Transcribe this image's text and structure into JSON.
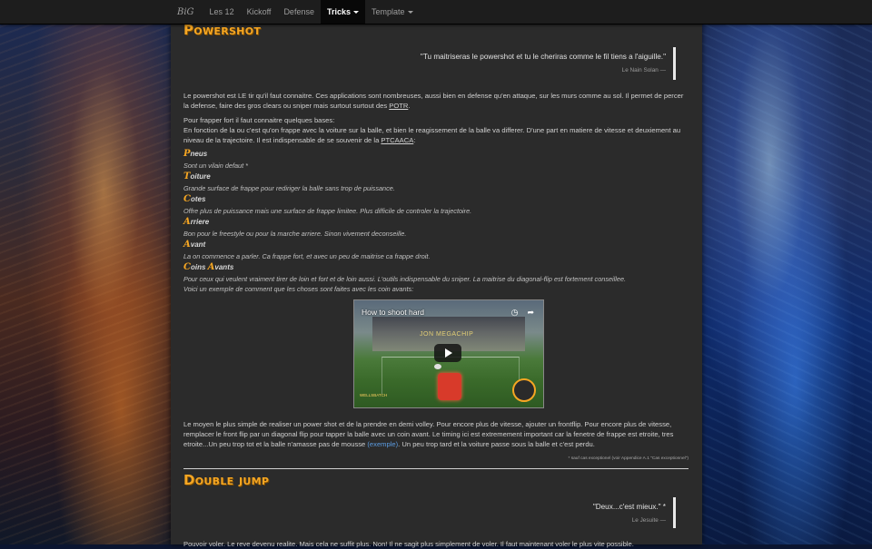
{
  "navbar": {
    "brand": "BiG",
    "items": [
      {
        "label": "Les 12"
      },
      {
        "label": "Kickoff"
      },
      {
        "label": "Defense"
      },
      {
        "label": "Tricks"
      },
      {
        "label": "Template"
      }
    ]
  },
  "sections": {
    "powershot": {
      "title": "Powershot",
      "quote_text": "\"Tu maitriseras le powershot et tu le cheriras comme le fil tiens a l'aiguille.\"",
      "quote_author": "Le Nain Solan —",
      "intro_before": "Le powershot est LE tir qu'il faut connaitre. Ces applications sont nombreuses, aussi bien en defense qu'en attaque, sur les murs comme au sol. Il permet de percer la defense, faire des gros clears ou sniper mais surtout surtout des ",
      "intro_link": "POTR",
      "intro_after": ".",
      "p2_line1": "Pour frapper fort il faut connaitre quelques bases:",
      "p2_body": "En fonction de la ou c'est qu'on frappe avec la voiture sur la balle, et bien le reagissement de la balle va differer. D'une part en matiere de vitesse et deuxiement au niveau de la trajectoire. Il est indispensable de se souvenir de la ",
      "p2_link": "PTCAACA",
      "p2_after": ":",
      "acronym": [
        {
          "letter": "P",
          "rest": "neus",
          "desc": "Sont un vilain defaut *"
        },
        {
          "letter": "T",
          "rest": "oiture",
          "desc": "Grande surface de frappe pour rediriger la balle sans trop de puissance."
        },
        {
          "letter": "C",
          "rest": "otes",
          "desc": "Offre plus de puissance mais une surface de frappe limitee. Plus difficile de controler la trajectoire."
        },
        {
          "letter": "A",
          "rest": "rriere",
          "desc": "Bon pour le freestyle ou pour la marche arriere. Sinon vivement deconseille."
        },
        {
          "letter": "A",
          "rest": "vant",
          "desc": "La on commence a parler. Ca frappe fort, et avec un peu de maitrise ca frappe droit."
        },
        {
          "letter": "C",
          "rest": "oins ",
          "letter2": "A",
          "rest2": "vants",
          "desc": "Pour ceux qui veulent vraiment tirer de loin et fort et de loin aussi. L'outils indispensable du sniper. La maitrise du diagonal-flip est fortement conseillee."
        }
      ],
      "video_intro": "Voici un exemple de comment que les choses sont faites avec les coin avants:",
      "video": {
        "title": "How to shoot hard",
        "overlay": "JON MEGACHIP",
        "tag": "WELLSBATCH"
      },
      "p3_before": "Le moyen le plus simple de realiser un power shot et de la prendre en demi volley. Pour encore plus de vitesse, ajouter un frontflip. Pour encore plus de vitesse, remplacer le front flip par un diagonal flip pour tapper la balle avec un coin avant. Le timing ici est extremement important car la fenetre de frappe est etroite, tres etroite...Un peu trop tot et la balle n'amasse pas de mousse ",
      "p3_link": "(exemple)",
      "p3_after": ". Un peu trop tard et la voiture passe sous la balle et c'est perdu.",
      "footnote": "* sauf cas exceptionel (voir Appendice A.1 \"Cas exceptionnel\")"
    },
    "doublejump": {
      "title": "Double jump",
      "quote_text": "\"Deux...c'est mieux.\" *",
      "quote_author": "Le Jesuite —",
      "intro": "Pouvoir voler. Le reve devenu realite. Mais cela ne suffit plus. Non! Il ne sagit plus simplement de voler. Il faut maintenant voler le plus vite possible."
    }
  },
  "colors": {
    "accent": "#f5a623",
    "panel": "#2b2b2b",
    "navbar": "#1d1d1d",
    "link": "#5b9be0"
  },
  "icons": [
    "clock-icon",
    "share-icon",
    "play-icon",
    "caret-down-icon"
  ]
}
